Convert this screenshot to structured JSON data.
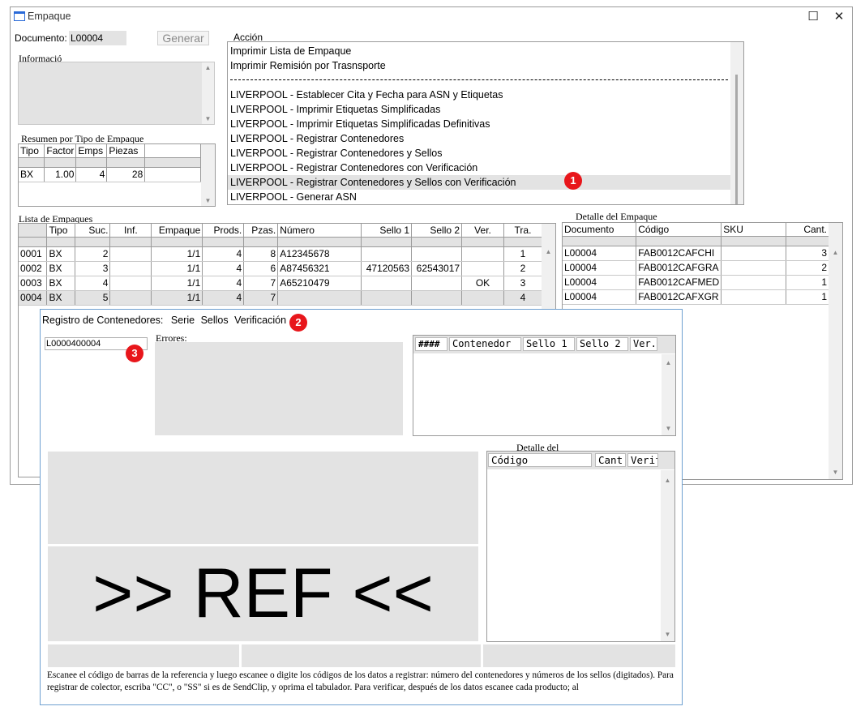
{
  "window": {
    "title": "Empaque",
    "maximize_glyph": "☐",
    "close_glyph": "✕"
  },
  "documento": {
    "label": "Documento:",
    "value": "L00004"
  },
  "generar_label": "Generar",
  "informacion_label": "Informació",
  "accion": {
    "label": "Acción",
    "items": [
      "Imprimir Lista de Empaque",
      "Imprimir Remisión por Trasnsporte",
      "LIVERPOOL - Establecer Cita y Fecha para ASN y Etiquetas",
      "LIVERPOOL - Imprimir Etiquetas Simplificadas",
      "LIVERPOOL - Imprimir Etiquetas Simplificadas Definitivas",
      "LIVERPOOL - Registrar Contenedores",
      "LIVERPOOL - Registrar Contenedores y Sellos",
      "LIVERPOOL - Registrar Contenedores con Verificación",
      "LIVERPOOL - Registrar Contenedores y Sellos con Verificación",
      "LIVERPOOL - Generar ASN"
    ],
    "selected_index": 8
  },
  "resumen": {
    "label": "Resumen por Tipo de Empaque",
    "headers": [
      "Tipo",
      "Factor",
      "Emps",
      "Piezas"
    ],
    "rows": [
      [
        "BX",
        "1.00",
        "4",
        "28"
      ]
    ]
  },
  "lista": {
    "label": "Lista de Empaques",
    "headers": [
      "Tipo",
      "Suc.",
      "Inf.",
      "Empaque",
      "Prods.",
      "Pzas.",
      "Número",
      "Sello 1",
      "Sello 2",
      "Ver.",
      "Tra."
    ],
    "rows": [
      [
        "0001",
        "BX",
        "2",
        "",
        "1/1",
        "4",
        "8",
        "A12345678",
        "",
        "",
        "",
        "1"
      ],
      [
        "0002",
        "BX",
        "3",
        "",
        "1/1",
        "4",
        "6",
        "A87456321",
        "47120563",
        "62543017",
        "",
        "2"
      ],
      [
        "0003",
        "BX",
        "4",
        "",
        "1/1",
        "4",
        "7",
        "A65210479",
        "",
        "",
        "OK",
        "3"
      ],
      [
        "0004",
        "BX",
        "5",
        "",
        "1/1",
        "4",
        "7",
        "",
        "",
        "",
        "",
        "4"
      ]
    ]
  },
  "detalle": {
    "label": "Detalle del Empaque",
    "headers": [
      "Documento",
      "Código",
      "SKU",
      "Cant."
    ],
    "rows": [
      [
        "L00004",
        "FAB0012CAFCHI",
        "",
        "3"
      ],
      [
        "L00004",
        "FAB0012CAFGRA",
        "",
        "2"
      ],
      [
        "L00004",
        "FAB0012CAFMED",
        "",
        "1"
      ],
      [
        "L00004",
        "FAB0012CAFXGR",
        "",
        "1"
      ]
    ]
  },
  "dialog": {
    "title": "Registro de Contenedores:",
    "tabs": [
      "Serie",
      "Sellos",
      "Verificación"
    ],
    "input_value": "L0000400004",
    "errores_label": "Errores:",
    "contenedores_headers": [
      "####",
      "Contenedor",
      "Sello 1",
      "Sello 2",
      "Ver."
    ],
    "detalle_label": "Detalle del",
    "detalle_headers": [
      "Código",
      "Cant.",
      "Verif."
    ],
    "ref_text": ">> REF <<",
    "instructions": "Escanee el código de barras de la referencia y luego escanee o digite los códigos de los datos a registrar: número del contenedores y números de los sellos (digitados). Para registrar de colector, escriba \"CC\", o \"SS\" si es de SendClip, y oprima el tabulador. Para verificar, después de los datos escanee cada producto; al"
  },
  "badges": [
    "1",
    "2",
    "3"
  ]
}
